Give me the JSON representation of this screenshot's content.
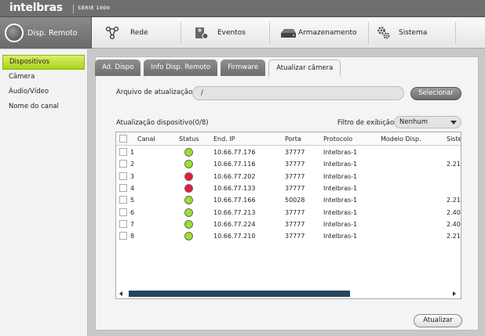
{
  "brand": {
    "logo": "intelbras",
    "series": "SÉRIE 1000"
  },
  "nav": {
    "items": [
      {
        "label": "Disp. Remoto",
        "icon": "remote-device-icon",
        "active": true
      },
      {
        "label": "Rede",
        "icon": "network-icon"
      },
      {
        "label": "Eventos",
        "icon": "events-icon"
      },
      {
        "label": "Armazenamento",
        "icon": "storage-icon"
      },
      {
        "label": "Sistema",
        "icon": "system-gears-icon"
      }
    ]
  },
  "sidebar": {
    "items": [
      {
        "label": "Dispositivos",
        "active": true
      },
      {
        "label": "Câmera"
      },
      {
        "label": "Áudio/Vídeo"
      },
      {
        "label": "Nome do canal"
      }
    ]
  },
  "tabs": [
    {
      "label": "Ad. Dispo"
    },
    {
      "label": "Info Disp. Remoto"
    },
    {
      "label": "Firmware"
    },
    {
      "label": "Atualizar câmera",
      "active": true
    }
  ],
  "update": {
    "file_label": "Arquivo de atualização",
    "file_value": "/",
    "select_button": "Selecionar",
    "count_label": "Atualização dispositivo(0/8)",
    "filter_label": "Filtro de exibição",
    "filter_value": "Nenhum",
    "update_button": "Atualizar"
  },
  "table": {
    "headers": [
      "Canal",
      "Status",
      "End. IP",
      "Porta",
      "Protocolo",
      "Modelo Disp.",
      "Siste"
    ],
    "rows": [
      {
        "canal": "1",
        "status": "online",
        "ip": "10.66.77.176",
        "porta": "37777",
        "protocolo": "Intelbras-1",
        "modelo": "",
        "sistema": ""
      },
      {
        "canal": "2",
        "status": "online",
        "ip": "10.66.77.116",
        "porta": "37777",
        "protocolo": "Intelbras-1",
        "modelo": "",
        "sistema": "2.21("
      },
      {
        "canal": "3",
        "status": "offline",
        "ip": "10.66.77.202",
        "porta": "37777",
        "protocolo": "Intelbras-1",
        "modelo": "",
        "sistema": ""
      },
      {
        "canal": "4",
        "status": "offline",
        "ip": "10.66.77.133",
        "porta": "37777",
        "protocolo": "Intelbras-1",
        "modelo": "",
        "sistema": ""
      },
      {
        "canal": "5",
        "status": "online",
        "ip": "10.66.77.166",
        "porta": "50028",
        "protocolo": "Intelbras-1",
        "modelo": "",
        "sistema": "2.21!"
      },
      {
        "canal": "6",
        "status": "online",
        "ip": "10.66.77.213",
        "porta": "37777",
        "protocolo": "Intelbras-1",
        "modelo": "",
        "sistema": "2.40("
      },
      {
        "canal": "7",
        "status": "online",
        "ip": "10.66.77.224",
        "porta": "37777",
        "protocolo": "Intelbras-1",
        "modelo": "",
        "sistema": "2.40("
      },
      {
        "canal": "8",
        "status": "online",
        "ip": "10.66.77.210",
        "porta": "37777",
        "protocolo": "Intelbras-1",
        "modelo": "",
        "sistema": "2.21("
      }
    ]
  },
  "colors": {
    "online": "#99e22e",
    "offline": "#e8193a",
    "active_green": "#a9d11c",
    "scroll_thumb": "#28455e"
  }
}
